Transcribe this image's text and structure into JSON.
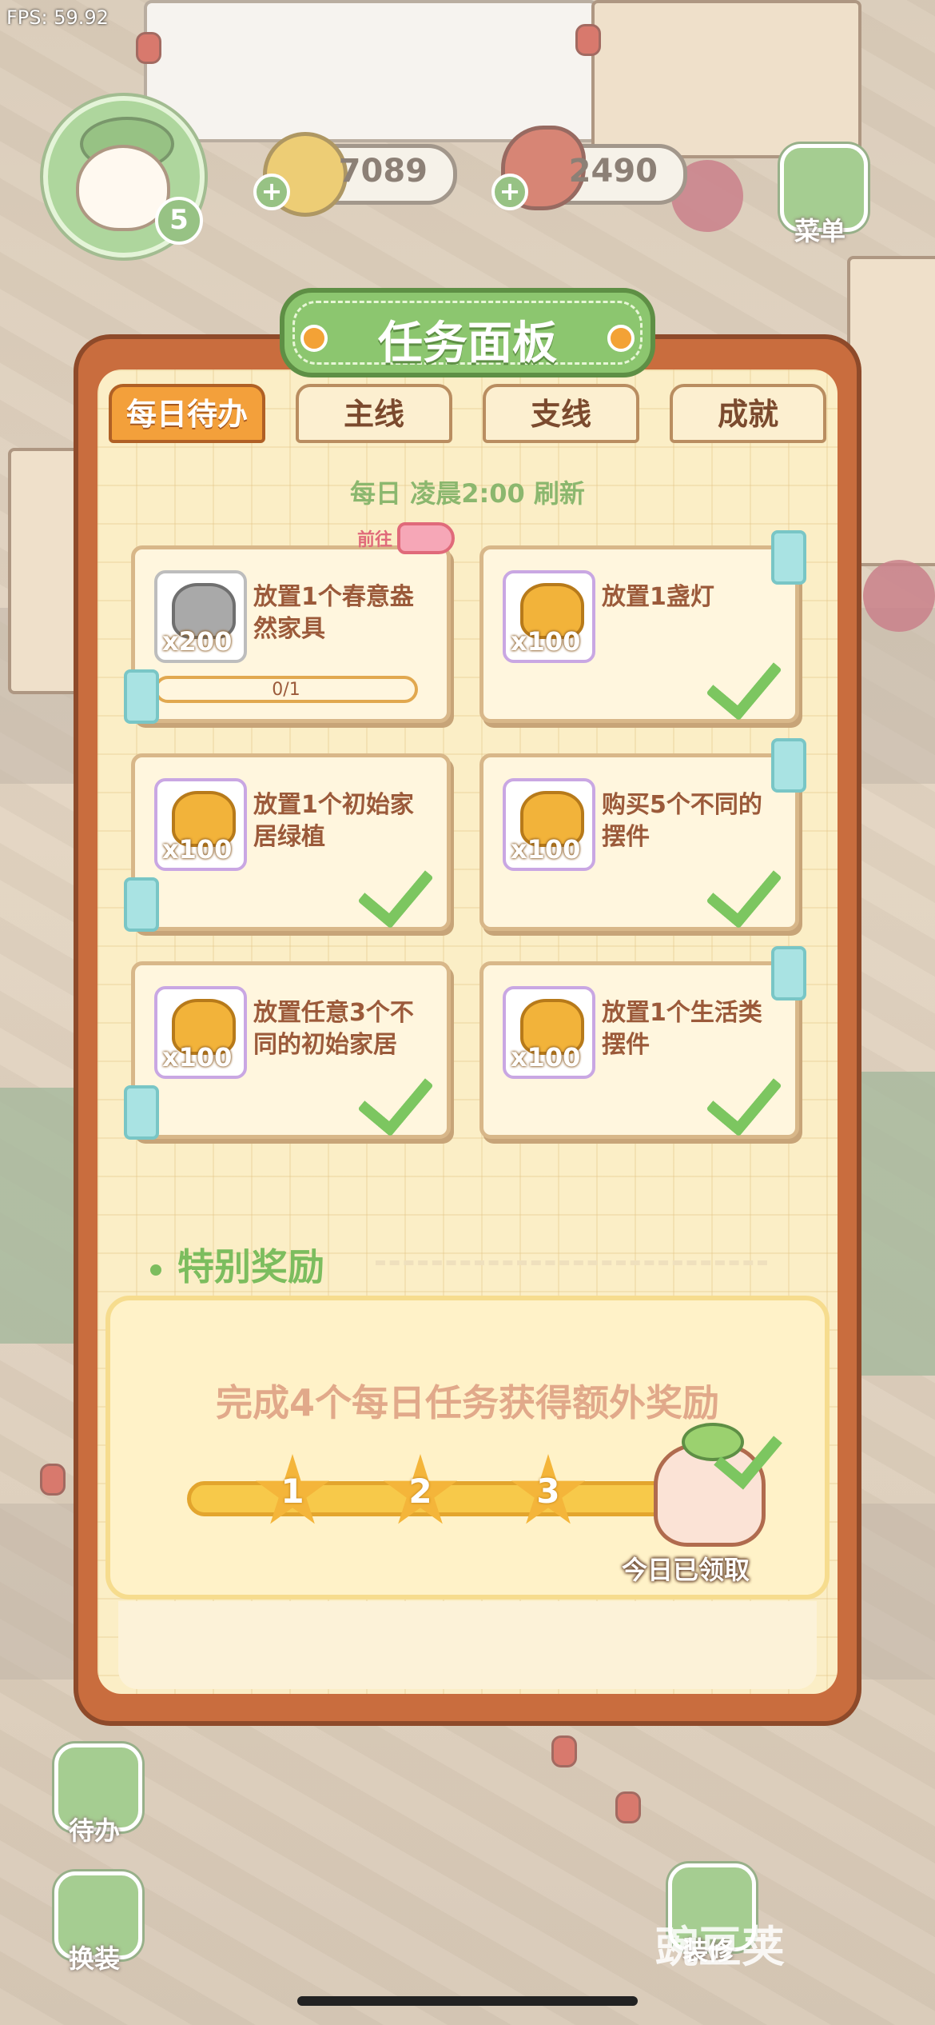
{
  "fps": "FPS: 59.92",
  "player": {
    "level": "5"
  },
  "currencies": {
    "coins": "7089",
    "food": "2490"
  },
  "side_buttons": {
    "menu": "菜单",
    "todo": "待办",
    "dress": "换装",
    "decorate": "装修"
  },
  "panel": {
    "title": "任务面板",
    "tabs": [
      "每日待办",
      "主线",
      "支线",
      "成就"
    ],
    "active_tab": 0,
    "refresh_note": "每日 凌晨2:00 刷新",
    "tasks": [
      {
        "reward_qty": "x200",
        "reward_type": "silver",
        "desc": "放置1个春意盎然家具",
        "progress": "0/1",
        "goto": "前往",
        "done": false
      },
      {
        "reward_qty": "x100",
        "reward_type": "gold",
        "desc": "放置1盏灯",
        "done": true
      },
      {
        "reward_qty": "x100",
        "reward_type": "gold",
        "desc": "放置1个初始家居绿植",
        "done": true
      },
      {
        "reward_qty": "x100",
        "reward_type": "gold",
        "desc": "购买5个不同的摆件",
        "done": true
      },
      {
        "reward_qty": "x100",
        "reward_type": "gold",
        "desc": "放置任意3个不同的初始家居",
        "done": true
      },
      {
        "reward_qty": "x100",
        "reward_type": "gold",
        "desc": "放置1个生活类摆件",
        "done": true
      }
    ],
    "special": {
      "title": "特别奖励",
      "text": "完成4个每日任务获得额外奖励",
      "milestones": [
        "1",
        "2",
        "3"
      ],
      "claimed_label": "今日已领取"
    }
  },
  "watermark": "豌豆荚"
}
